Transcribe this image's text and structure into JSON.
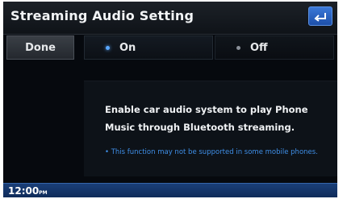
{
  "header": {
    "title": "Streaming Audio Setting",
    "back_icon": "back-arrow-icon"
  },
  "options": {
    "done_label": "Done",
    "on_label": "On",
    "off_label": "Off",
    "selected": "On"
  },
  "content": {
    "description": "Enable car audio system to play Phone Music through Bluetooth streaming.",
    "note": "• This function may not be supported in some mobile phones."
  },
  "status_bar": {
    "time": "12:00",
    "ampm": "PM"
  },
  "colors": {
    "accent": "#3f8fe8",
    "status_bar": "#1a3f78"
  }
}
